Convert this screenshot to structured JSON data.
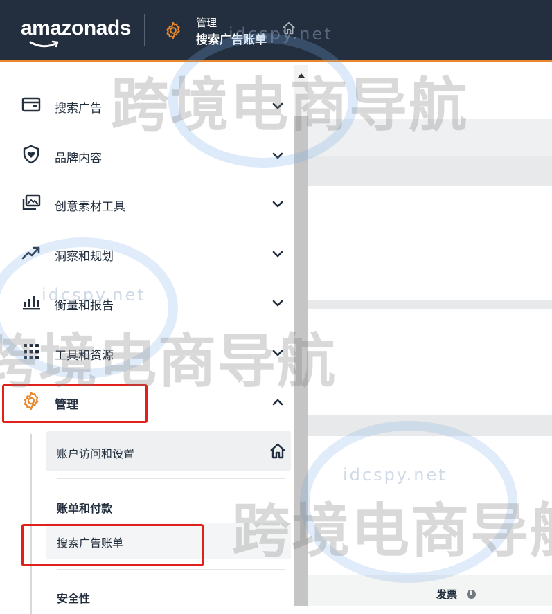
{
  "header": {
    "logo_text": "amazonads",
    "breadcrumb_parent": "管理",
    "breadcrumb_current": "搜索广告账单",
    "accent_color": "#e8872b",
    "background_color": "#232f3e"
  },
  "sidebar": {
    "items": [
      {
        "label": "搜索广告",
        "icon": "wallet-icon",
        "expanded": false
      },
      {
        "label": "品牌内容",
        "icon": "shield-heart-icon",
        "expanded": false
      },
      {
        "label": "创意素材工具",
        "icon": "image-gallery-icon",
        "expanded": false
      },
      {
        "label": "洞察和规划",
        "icon": "trend-chart-icon",
        "expanded": false
      },
      {
        "label": "衡量和报告",
        "icon": "bar-chart-icon",
        "expanded": false
      },
      {
        "label": "工具和资源",
        "icon": "grid-icon",
        "expanded": false
      },
      {
        "label": "管理",
        "icon": "gear-icon",
        "expanded": true
      }
    ],
    "submenu": {
      "account_item": {
        "label": "账户访问和设置",
        "icon": "home-icon"
      },
      "billing_group_title": "账单和付款",
      "billing_item": {
        "label": "搜索广告账单"
      },
      "security_group_title": "安全性"
    }
  },
  "main": {
    "column_header": "发票",
    "column_info_icon": "info-icon"
  },
  "watermark": {
    "brand_text": "跨境电商导航",
    "domain_text": "idcspy.net"
  },
  "colors": {
    "highlight": "#e0201a",
    "gear_orange": "#e8872b"
  }
}
